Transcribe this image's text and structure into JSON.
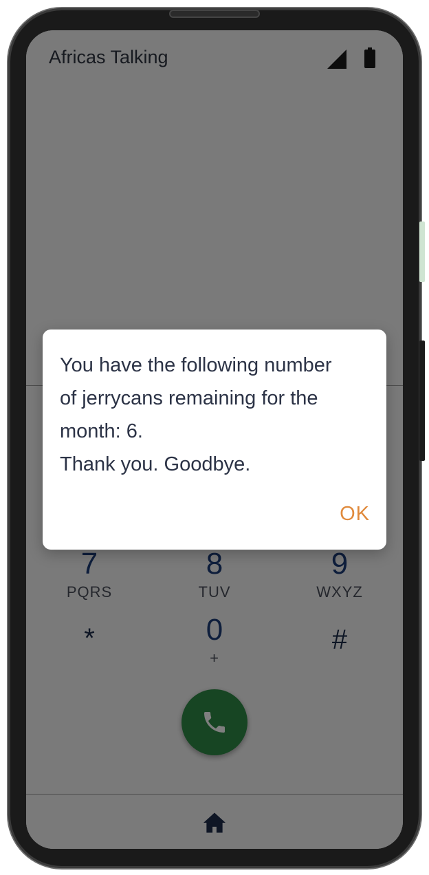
{
  "status_bar": {
    "app_title": "Africas Talking",
    "signal_icon": "signal-icon",
    "battery_icon": "battery-icon"
  },
  "keypad": {
    "keys": [
      {
        "digit": "7",
        "letters": "PQRS"
      },
      {
        "digit": "8",
        "letters": "TUV"
      },
      {
        "digit": "9",
        "letters": "WXYZ"
      },
      {
        "digit": "*",
        "letters": ""
      },
      {
        "digit": "0",
        "letters": "+"
      },
      {
        "digit": "#",
        "letters": ""
      }
    ]
  },
  "call_button": {
    "icon": "phone-icon",
    "color": "#2f8a46"
  },
  "bottom_nav": {
    "home_icon": "home-icon"
  },
  "dialog": {
    "message": "You have the following number\nof jerrycans remaining for the\nmonth: 6.\nThank you. Goodbye.",
    "ok_label": "OK",
    "accent_color": "#e08a3c"
  }
}
